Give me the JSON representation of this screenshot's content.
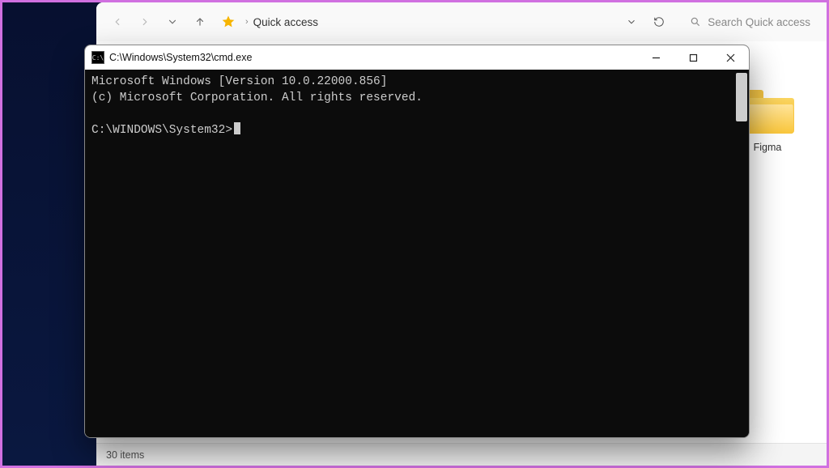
{
  "explorer": {
    "breadcrumb": "Quick access",
    "search_placeholder": "Search Quick access",
    "folder_label": "Figma",
    "status": "30 items"
  },
  "cmd": {
    "title": "C:\\Windows\\System32\\cmd.exe",
    "icon_glyph": "C:\\",
    "line1": "Microsoft Windows [Version 10.0.22000.856]",
    "line2": "(c) Microsoft Corporation. All rights reserved.",
    "prompt": "C:\\WINDOWS\\System32>"
  }
}
